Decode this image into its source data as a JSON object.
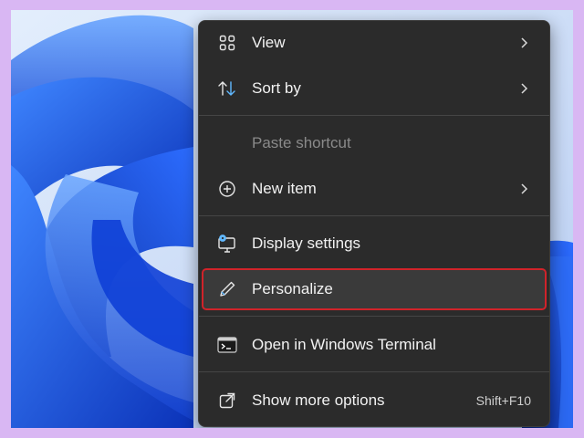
{
  "menu": {
    "items": [
      {
        "label": "View",
        "icon": "grid-icon",
        "submenu": true
      },
      {
        "label": "Sort by",
        "icon": "sort-arrows-icon",
        "submenu": true
      },
      {
        "label": "Paste shortcut",
        "disabled": true
      },
      {
        "label": "New item",
        "icon": "plus-circle-icon",
        "submenu": true
      },
      {
        "label": "Display settings",
        "icon": "monitor-settings-icon"
      },
      {
        "label": "Personalize",
        "icon": "pen-icon",
        "highlighted": true
      },
      {
        "label": "Open in Windows Terminal",
        "icon": "terminal-icon"
      },
      {
        "label": "Show more options",
        "icon": "open-external-icon",
        "shortcut": "Shift+F10"
      }
    ]
  },
  "colors": {
    "menu_background": "#2b2b2b",
    "highlight_outline": "#d1232a",
    "page_border": "#d9b7f3",
    "wallpaper_blue": "#1e5be6"
  }
}
